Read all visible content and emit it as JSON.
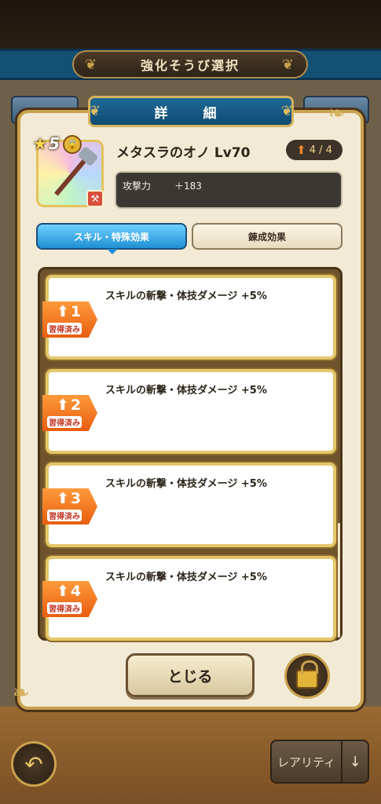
{
  "screen": {
    "title": "強化そうび選択",
    "back_icon": "undo-arrow-icon",
    "rarity_button": "レアリティ",
    "rarity_arrow_icon": "arrow-down-icon"
  },
  "dialog": {
    "title": "詳　細",
    "equipment": {
      "name": "メタスラのオノ Lv70",
      "stars": "5",
      "upgrade_progress": "4 / 4",
      "stat_label": "攻撃力",
      "stat_value": "＋183",
      "rarity_color": "#e2c35c"
    },
    "tabs": [
      {
        "label": "スキル・特殊効果",
        "active": true
      },
      {
        "label": "錬成効果",
        "active": false
      }
    ],
    "skills": [
      {
        "level": "1",
        "status": "習得済み",
        "description": "スキルの斬撃・体技ダメージ +5%"
      },
      {
        "level": "2",
        "status": "習得済み",
        "description": "スキルの斬撃・体技ダメージ +5%"
      },
      {
        "level": "3",
        "status": "習得済み",
        "description": "スキルの斬撃・体技ダメージ +5%"
      },
      {
        "level": "4",
        "status": "習得済み",
        "description": "スキルの斬撃・体技ダメージ +5%"
      }
    ],
    "close_label": "とじる",
    "lock_icon": "padlock-icon"
  },
  "colors": {
    "accent_blue": "#1f8fd4",
    "skill_orange": "#e85d10",
    "gold": "#c9a24e"
  }
}
